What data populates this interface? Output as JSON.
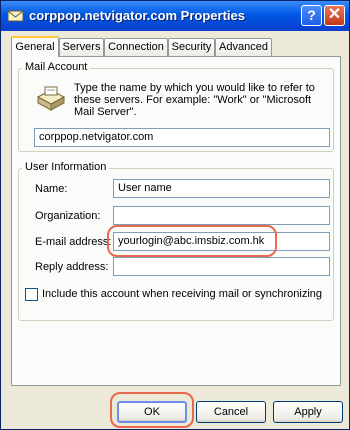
{
  "window": {
    "title": "corppop.netvigator.com Properties",
    "help_label": "?",
    "close_label": "✕"
  },
  "tabs": [
    {
      "label": "General",
      "active": true
    },
    {
      "label": "Servers"
    },
    {
      "label": "Connection"
    },
    {
      "label": "Security"
    },
    {
      "label": "Advanced"
    }
  ],
  "mail_account": {
    "group_label": "Mail Account",
    "description": "Type the name by which you would like to refer to these servers.  For example: \"Work\" or \"Microsoft Mail Server\".",
    "account_name": "corppop.netvigator.com"
  },
  "user_information": {
    "group_label": "User Information",
    "name_label": "Name:",
    "name_value": "User name",
    "organization_label": "Organization:",
    "organization_value": "",
    "email_label": "E-mail address:",
    "email_value": "yourlogin@abc.imsbiz.com.hk",
    "reply_label": "Reply address:",
    "reply_value": ""
  },
  "include_checkbox": {
    "label": "Include this account when receiving mail or synchronizing",
    "checked": false
  },
  "buttons": {
    "ok": "OK",
    "cancel": "Cancel",
    "apply": "Apply"
  },
  "colors": {
    "titlebar": "#0058e6",
    "highlight": "#e86a4e",
    "dialog_bg": "#ece9d8"
  }
}
